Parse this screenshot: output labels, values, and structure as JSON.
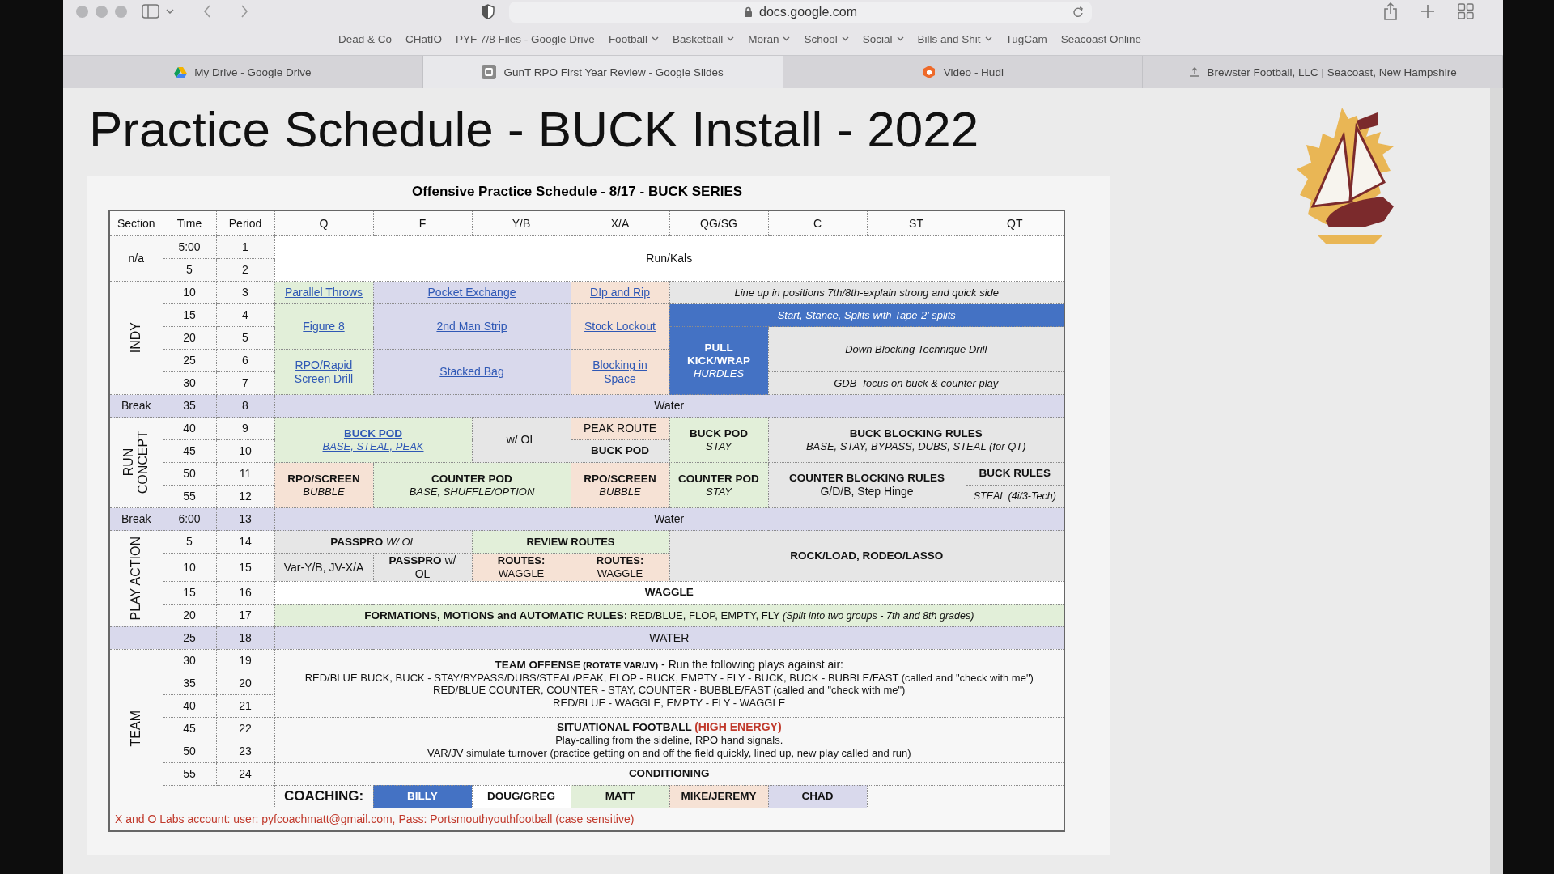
{
  "browser": {
    "address": "docs.google.com",
    "bookmarks": [
      {
        "label": "Dead & Co",
        "menu": false
      },
      {
        "label": "CHatIO",
        "menu": false
      },
      {
        "label": "PYF 7/8 Files - Google Drive",
        "menu": false
      },
      {
        "label": "Football",
        "menu": true
      },
      {
        "label": "Basketball",
        "menu": true
      },
      {
        "label": "Moran",
        "menu": true
      },
      {
        "label": "School",
        "menu": true
      },
      {
        "label": "Social",
        "menu": true
      },
      {
        "label": "Bills and Shit",
        "menu": true
      },
      {
        "label": "TugCam",
        "menu": false
      },
      {
        "label": "Seacoast Online",
        "menu": false
      }
    ],
    "tabs": [
      {
        "title": "My Drive - Google Drive",
        "kind": "drive",
        "selected": false
      },
      {
        "title": "GunT RPO First Year Review - Google Slides",
        "kind": "slides",
        "selected": true
      },
      {
        "title": "Video - Hudl",
        "kind": "hudl",
        "selected": false
      },
      {
        "title": "Brewster Football, LLC | Seacoast, New Hampshire",
        "kind": "upload",
        "selected": false
      }
    ]
  },
  "slide": {
    "title": "Practice Schedule - BUCK Install - 2022",
    "table": {
      "title": "Offensive Practice Schedule - 8/17 - BUCK SERIES",
      "columns": [
        "Section",
        "Time",
        "Period",
        "Q",
        "F",
        "Y/B",
        "X/A",
        "QG/SG",
        "C",
        "ST",
        "QT"
      ],
      "rows": [
        {
          "cells": [
            {
              "text": "n/a",
              "rowspan": 2
            },
            {
              "text": "5:00"
            },
            {
              "text": "1"
            },
            {
              "text": "Run/Kals",
              "colspan": 8,
              "rowspan": 2,
              "color": "#ffffff"
            }
          ]
        },
        {
          "cells": [
            {
              "text": "5"
            },
            {
              "text": "2"
            }
          ]
        },
        {
          "cells": [
            {
              "text": "INDY",
              "kind": "vertical",
              "rowspan": 5
            },
            {
              "text": "10"
            },
            {
              "text": "3"
            },
            {
              "text": "Parallel Throws",
              "kind": "link",
              "color": "#e2efd9"
            },
            {
              "text": "Pocket Exchange",
              "kind": "link",
              "colspan": 2,
              "color": "#d9d9ec"
            },
            {
              "text": "DIp and Rip",
              "kind": "link",
              "color": "#f6e2d5"
            },
            {
              "text": "Line up in positions 7th/8th-explain strong and quick side",
              "kind": "italic",
              "colspan": 4,
              "color": "#e6e6e6"
            }
          ]
        },
        {
          "cells": [
            {
              "text": "15"
            },
            {
              "text": "4"
            },
            {
              "text": "Figure 8",
              "kind": "link",
              "rowspan": 2,
              "color": "#e2efd9"
            },
            {
              "text": "2nd Man Strip",
              "kind": "link",
              "colspan": 2,
              "rowspan": 2,
              "color": "#d9d9ec"
            },
            {
              "text": "Stock Lockout",
              "kind": "link",
              "rowspan": 2,
              "color": "#f6e2d5"
            },
            {
              "text": "Start, Stance, Splits with Tape-2' splits",
              "kind": "italic",
              "colspan": 4,
              "color": "#4472c4"
            }
          ]
        },
        {
          "cells": [
            {
              "text": "20"
            },
            {
              "text": "5"
            },
            {
              "lines": [
                {
                  "text": "PULL KICK/WRAP",
                  "kind": "bold"
                },
                {
                  "text": "HURDLES",
                  "kind": "italic"
                }
              ],
              "rowspan": 3,
              "color": "#4472c4"
            },
            {
              "text": "Down Blocking Technique Drill",
              "kind": "italic",
              "colspan": 3,
              "rowspan": 2,
              "color": "#e6e6e6"
            }
          ]
        },
        {
          "cells": [
            {
              "text": "25"
            },
            {
              "text": "6"
            },
            {
              "lines": [
                {
                  "text": "RPO/Rapid",
                  "kind": "link"
                },
                {
                  "text": "Screen Drill",
                  "kind": "link"
                }
              ],
              "rowspan": 2,
              "color": "#e2efd9"
            },
            {
              "text": "Stacked Bag",
              "kind": "link",
              "colspan": 2,
              "rowspan": 2,
              "color": "#d9d9ec"
            },
            {
              "lines": [
                {
                  "text": "Blocking in",
                  "kind": "link"
                },
                {
                  "text": "Space",
                  "kind": "link"
                }
              ],
              "rowspan": 2,
              "color": "#f6e2d5"
            }
          ]
        },
        {
          "cells": [
            {
              "text": "30"
            },
            {
              "text": "7"
            },
            {
              "text": "GDB- focus on buck & counter play",
              "kind": "italic",
              "colspan": 3,
              "color": "#e6e6e6"
            }
          ]
        },
        {
          "cells": [
            {
              "text": "Break",
              "color": "#d9d9ec"
            },
            {
              "text": "35",
              "color": "#d9d9ec"
            },
            {
              "text": "8",
              "color": "#d9d9ec"
            },
            {
              "text": "Water",
              "colspan": 8,
              "color": "#d9d9ec"
            }
          ]
        },
        {
          "cells": [
            {
              "lines": [
                {
                  "text": "RUN"
                },
                {
                  "text": "CONCEPT"
                }
              ],
              "kind": "vertical",
              "rowspan": 4
            },
            {
              "text": "40"
            },
            {
              "text": "9"
            },
            {
              "lines": [
                {
                  "text": "BUCK POD",
                  "kind": "bold-link"
                },
                {
                  "text": "BASE, STEAL, PEAK",
                  "kind": "italic-link"
                }
              ],
              "colspan": 2,
              "rowspan": 2,
              "color": "#e2efd9"
            },
            {
              "text": "w/ OL",
              "rowspan": 2,
              "color": "#e6e6e6"
            },
            {
              "text": "PEAK ROUTE",
              "color": "#f6e2d5"
            },
            {
              "lines": [
                {
                  "text": "BUCK POD",
                  "kind": "bold"
                },
                {
                  "text": "STAY",
                  "kind": "italic"
                }
              ],
              "rowspan": 2,
              "color": "#e2efd9"
            },
            {
              "lines": [
                {
                  "text": "BUCK BLOCKING RULES",
                  "kind": "bold"
                },
                {
                  "text": "BASE, STAY, BYPASS, DUBS, STEAL (for QT)",
                  "kind": "italic"
                }
              ],
              "colspan": 3,
              "rowspan": 2,
              "color": "#e6e6e6"
            }
          ]
        },
        {
          "cells": [
            {
              "text": "45"
            },
            {
              "text": "10"
            },
            {
              "text": "BUCK POD",
              "kind": "bold",
              "color": "#e6e6e6"
            }
          ]
        },
        {
          "cells": [
            {
              "text": "50"
            },
            {
              "text": "11"
            },
            {
              "lines": [
                {
                  "text": "RPO/SCREEN",
                  "kind": "bold"
                },
                {
                  "text": "BUBBLE",
                  "kind": "italic"
                }
              ],
              "rowspan": 2,
              "color": "#f6e2d5"
            },
            {
              "lines": [
                {
                  "text": "COUNTER POD",
                  "kind": "bold"
                },
                {
                  "text": "BASE, SHUFFLE/OPTION",
                  "kind": "italic"
                }
              ],
              "colspan": 2,
              "rowspan": 2,
              "color": "#e2efd9"
            },
            {
              "lines": [
                {
                  "text": "RPO/SCREEN",
                  "kind": "bold"
                },
                {
                  "text": "BUBBLE",
                  "kind": "italic"
                }
              ],
              "rowspan": 2,
              "color": "#f6e2d5"
            },
            {
              "lines": [
                {
                  "text": "COUNTER POD",
                  "kind": "bold"
                },
                {
                  "text": "STAY",
                  "kind": "italic"
                }
              ],
              "rowspan": 2,
              "color": "#e2efd9"
            },
            {
              "lines": [
                {
                  "text": "COUNTER BLOCKING RULES",
                  "kind": "bold"
                },
                {
                  "text": "G/D/B, Step Hinge",
                  "kind": "plain"
                }
              ],
              "colspan": 2,
              "rowspan": 2,
              "color": "#e6e6e6"
            },
            {
              "text": "BUCK  RULES",
              "kind": "bold",
              "color": "#e6e6e6"
            }
          ]
        },
        {
          "cells": [
            {
              "text": "55"
            },
            {
              "text": "12"
            },
            {
              "text": "STEAL (4i/3-Tech)",
              "kind": "small-italic",
              "color": "#e6e6e6"
            }
          ]
        },
        {
          "cells": [
            {
              "text": "Break",
              "color": "#d9d9ec"
            },
            {
              "text": "6:00",
              "color": "#d9d9ec"
            },
            {
              "text": "13",
              "color": "#d9d9ec"
            },
            {
              "text": "Water",
              "colspan": 8,
              "color": "#d9d9ec"
            }
          ]
        },
        {
          "cells": [
            {
              "text": "PLAY ACTION",
              "kind": "vertical",
              "rowspan": 4
            },
            {
              "text": "5"
            },
            {
              "text": "14"
            },
            {
              "lines": [
                {
                  "parts": [
                    {
                      "text": "PASSPRO ",
                      "kind": "bold"
                    },
                    {
                      "text": "W/ OL",
                      "kind": "italic"
                    }
                  ]
                }
              ],
              "colspan": 2,
              "color": "#e6e6e6"
            },
            {
              "text": "REVIEW ROUTES",
              "kind": "small-bold",
              "colspan": 2,
              "color": "#e2efd9"
            },
            {
              "text": "ROCK/LOAD, RODEO/LASSO",
              "kind": "bold",
              "colspan": 4,
              "rowspan": 2,
              "color": "#e6e6e6"
            }
          ]
        },
        {
          "cells": [
            {
              "text": "10"
            },
            {
              "text": "15"
            },
            {
              "text": "Var-Y/B, JV-X/A",
              "color": "#e6e6e6"
            },
            {
              "lines": [
                {
                  "parts": [
                    {
                      "text": "PASSPRO",
                      "kind": "bold"
                    },
                    {
                      "text": " w/",
                      "kind": "plain"
                    }
                  ]
                },
                {
                  "text": "OL"
                }
              ],
              "color": "#e6e6e6"
            },
            {
              "lines": [
                {
                  "text": "ROUTES:",
                  "kind": "small-bold"
                },
                {
                  "text": "WAGGLE",
                  "kind": "small"
                }
              ],
              "color": "#f6e2d5"
            },
            {
              "lines": [
                {
                  "text": "ROUTES:",
                  "kind": "small-bold"
                },
                {
                  "text": "WAGGLE",
                  "kind": "small"
                }
              ],
              "color": "#f6e2d5"
            }
          ]
        },
        {
          "cells": [
            {
              "text": "15"
            },
            {
              "text": "16"
            },
            {
              "text": "WAGGLE",
              "kind": "bold",
              "colspan": 8,
              "color": "#ffffff"
            }
          ]
        },
        {
          "cells": [
            {
              "text": "20"
            },
            {
              "text": "17"
            },
            {
              "lines": [
                {
                  "parts": [
                    {
                      "text": "FORMATIONS, MOTIONS and AUTOMATIC RULES:",
                      "kind": "bold"
                    },
                    {
                      "text": " RED/BLUE, FLOP, EMPTY, FLY ",
                      "kind": "small"
                    },
                    {
                      "text": "(Split into two groups - 7th and 8th grades)",
                      "kind": "small-italic"
                    }
                  ]
                }
              ],
              "colspan": 8,
              "color": "#e2efd9"
            }
          ]
        },
        {
          "cells": [
            {
              "color": "#d9d9ec"
            },
            {
              "text": "25",
              "color": "#d9d9ec"
            },
            {
              "text": "18",
              "color": "#d9d9ec"
            },
            {
              "text": "WATER",
              "colspan": 8,
              "color": "#d9d9ec"
            }
          ]
        },
        {
          "cells": [
            {
              "text": "TEAM",
              "kind": "vertical",
              "rowspan": 7
            },
            {
              "text": "30"
            },
            {
              "text": "19"
            },
            {
              "lines": [
                {
                  "parts": [
                    {
                      "text": "TEAM OFFENSE",
                      "kind": "bold"
                    },
                    {
                      "text": " (ROTATE VAR/JV)",
                      "kind": "tiny-bold"
                    },
                    {
                      "text": " - Run the following plays against air:",
                      "kind": "plain"
                    }
                  ]
                },
                {
                  "text": "RED/BLUE BUCK, BUCK - STAY/BYPASS/DUBS/STEAL/PEAK, FLOP - BUCK, EMPTY - FLY - BUCK, BUCK - BUBBLE/FAST (called and \"check with me\")",
                  "kind": "small"
                },
                {
                  "text": "RED/BLUE COUNTER, COUNTER - STAY, COUNTER - BUBBLE/FAST (called and \"check with me\")",
                  "kind": "small"
                },
                {
                  "text": "RED/BLUE - WAGGLE, EMPTY - FLY - WAGGLE",
                  "kind": "small"
                }
              ],
              "colspan": 8,
              "rowspan": 3
            }
          ]
        },
        {
          "cells": [
            {
              "text": "35"
            },
            {
              "text": "20"
            }
          ]
        },
        {
          "cells": [
            {
              "text": "40"
            },
            {
              "text": "21"
            }
          ]
        },
        {
          "cells": [
            {
              "text": "45"
            },
            {
              "text": "22"
            },
            {
              "lines": [
                {
                  "parts": [
                    {
                      "text": "SITUATIONAL FOOTBALL ",
                      "kind": "bold"
                    },
                    {
                      "text": "(HIGH ENERGY)",
                      "kind": "red-bold"
                    }
                  ]
                },
                {
                  "text": "Play-calling from the sideline, RPO hand signals.",
                  "kind": "small"
                },
                {
                  "text": "VAR/JV simulate turnover (practice getting on and off the field quickly, lined up, new play called and run)",
                  "kind": "small"
                }
              ],
              "colspan": 8,
              "rowspan": 2
            }
          ]
        },
        {
          "cells": [
            {
              "text": "50"
            },
            {
              "text": "23"
            }
          ]
        },
        {
          "cells": [
            {
              "text": "55"
            },
            {
              "text": "24"
            },
            {
              "text": "CONDITIONING",
              "kind": "bold",
              "colspan": 8
            }
          ]
        },
        {
          "cells": [
            {
              "colspan": 2
            },
            {
              "text": "COACHING:",
              "kind": "large-bold"
            },
            {
              "text": "BILLY",
              "kind": "bold",
              "color": "#4472c4"
            },
            {
              "text": "DOUG/GREG",
              "kind": "bold",
              "color": "#ffffff"
            },
            {
              "text": "MATT",
              "kind": "bold",
              "color": "#e2efd9"
            },
            {
              "text": "MIKE/JEREMY",
              "kind": "bold",
              "color": "#f6e2d5"
            },
            {
              "text": "CHAD",
              "kind": "bold",
              "color": "#d9d9ec"
            },
            {
              "colspan": 2
            }
          ]
        }
      ],
      "footer": "X and O Labs account: user: pyfcoachmatt@gmail.com, Pass: Portsmouthyouthfootball (case sensitive)"
    }
  }
}
